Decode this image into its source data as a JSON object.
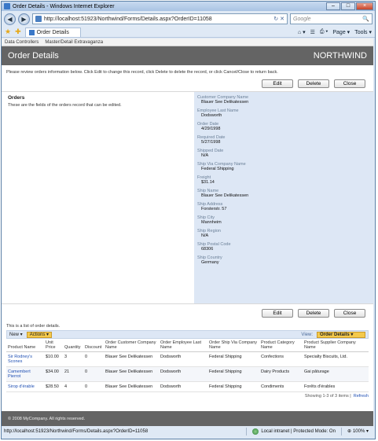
{
  "window": {
    "title": "Order Details - Windows Internet Explorer",
    "min": "–",
    "max": "□",
    "close": "×"
  },
  "browser": {
    "back": "◀",
    "forward": "▶",
    "url": "http://localhost:51923/Northwind/Forms/Details.aspx?OrderID=11058",
    "refresh_glyph": "↻",
    "stop_glyph": "✕",
    "search_placeholder": "Google",
    "search_glyph": "🔍",
    "tab_label": "Order Details",
    "cmd_home": "⌂ ▾",
    "cmd_feeds": "☰",
    "cmd_print": "⎙ ▾",
    "cmd_page": "Page ▾",
    "cmd_tools": "Tools ▾"
  },
  "menu": {
    "item1": "Data Controllers",
    "item2": "Master/Detail Extravaganza"
  },
  "header": {
    "title": "Order Details",
    "brand": "NORTHWIND"
  },
  "intro": "Please review orders information below. Click Edit to change this record, click Delete to delete the record, or click Cancel/Close to return back.",
  "buttons": {
    "edit": "Edit",
    "delete": "Delete",
    "close": "Close"
  },
  "form": {
    "heading": "Orders",
    "description": "These are the fields of the orders record that can be edited.",
    "fields": [
      {
        "label": "Customer Company Name",
        "value": "Blauer See Delikatessen"
      },
      {
        "label": "Employee Last Name",
        "value": "Dodsworth"
      },
      {
        "label": "Order Date",
        "value": "4/29/1998"
      },
      {
        "label": "Required Date",
        "value": "5/27/1998"
      },
      {
        "label": "Shipped Date",
        "value": "N/A"
      },
      {
        "label": "Ship Via Company Name",
        "value": "Federal Shipping"
      },
      {
        "label": "Freight",
        "value": "$31.14"
      },
      {
        "label": "Ship Name",
        "value": "Blauer See Delikatessen"
      },
      {
        "label": "Ship Address",
        "value": "Forsterstr. 57"
      },
      {
        "label": "Ship City",
        "value": "Mannheim"
      },
      {
        "label": "Ship Region",
        "value": "N/A"
      },
      {
        "label": "Ship Postal Code",
        "value": "68306"
      },
      {
        "label": "Ship Country",
        "value": "Germany"
      }
    ]
  },
  "list": {
    "intro": "This is a list of order details.",
    "new_label": "New ▾",
    "actions_label": "Actions ▾",
    "view_label": "View:",
    "view_value": "Order Details ▾",
    "columns": [
      "Product Name",
      "Unit Price",
      "Quantity",
      "Discount",
      "Order Customer Company Name",
      "Order Employee Last Name",
      "Order Ship Via Company Name",
      "Product Category Name",
      "Product Supplier Company Name"
    ],
    "rows": [
      [
        "Sir Rodney's Scones",
        "$10.00",
        "3",
        "0",
        "Blauer See Delikatessen",
        "Dodsworth",
        "Federal Shipping",
        "Confections",
        "Specialty Biscuits, Ltd."
      ],
      [
        "Camembert Pierrot",
        "$34.00",
        "21",
        "0",
        "Blauer See Delikatessen",
        "Dodsworth",
        "Federal Shipping",
        "Dairy Products",
        "Gai pâturage"
      ],
      [
        "Sirop d'érable",
        "$28.50",
        "4",
        "0",
        "Blauer See Delikatessen",
        "Dodsworth",
        "Federal Shipping",
        "Condiments",
        "Forêts d'érables"
      ]
    ],
    "pager_text": "Showing 1-3 of 3 items |",
    "refresh": "Refresh"
  },
  "footer": "© 2008 MyCompany. All rights reserved.",
  "status": {
    "url": "http://localhost:51923/Northwind/Forms/Details.aspx?OrderID=11058",
    "zone": "Local intranet | Protected Mode: On",
    "zoom": "100% ▾"
  }
}
